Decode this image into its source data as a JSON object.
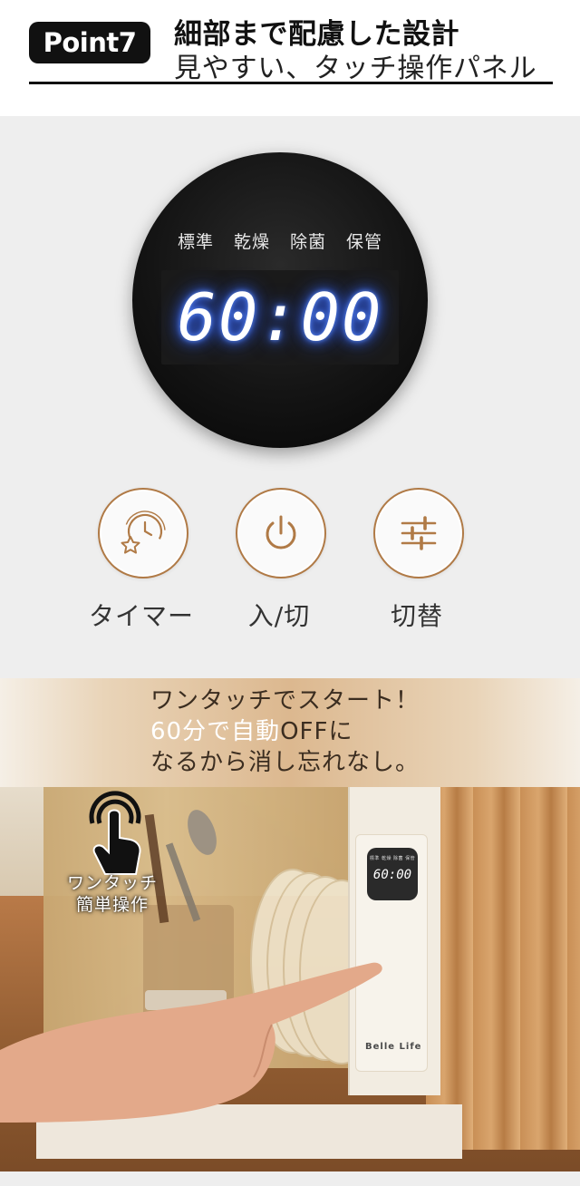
{
  "header": {
    "badge": "Point7",
    "title": "細部まで配慮した設計",
    "subtitle": "見やすい、タッチ操作パネル"
  },
  "panel": {
    "modes": [
      "標準",
      "乾燥",
      "除菌",
      "保管"
    ],
    "display_time": "60:00",
    "accent_color": "#b07a46",
    "buttons": [
      {
        "icon": "timer-star-icon",
        "label": "タイマー"
      },
      {
        "icon": "power-icon",
        "label": "入/切"
      },
      {
        "icon": "sliders-icon",
        "label": "切替"
      }
    ]
  },
  "promo": {
    "line1": "ワンタッチでスタート！",
    "line2_white": "60分で自動",
    "line2_dark_off": "OFF",
    "line2_dark_end": "に",
    "line3": "なるから消し忘れなし。"
  },
  "photo": {
    "touch_label_line1": "ワンタッチ",
    "touch_label_line2": "簡単操作",
    "mini_modes": "標準 乾燥 除菌 保管",
    "mini_time": "60:00",
    "brand": "Belle Life"
  }
}
